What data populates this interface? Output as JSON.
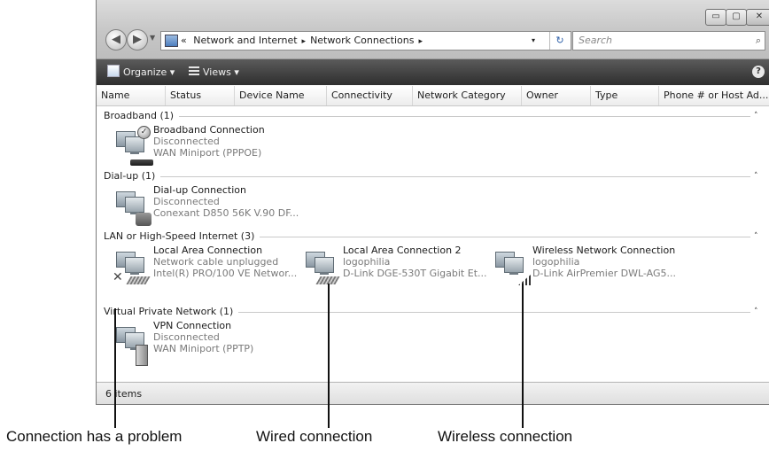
{
  "window": {
    "controls": {
      "minimize": "▭",
      "maximize": "▢",
      "close": "✕"
    }
  },
  "nav": {
    "back_glyph": "◀",
    "forward_glyph": "▶",
    "history_drop": "▼"
  },
  "address": {
    "overflow": "«",
    "crumbs": [
      "Network and Internet",
      "Network Connections"
    ],
    "separator": "▸",
    "drop": "▾",
    "refresh": "↻"
  },
  "search": {
    "placeholder": "Search",
    "icon": "⌕"
  },
  "toolbar": {
    "organize_label": "Organize ▾",
    "views_label": "Views ▾",
    "help_label": "?"
  },
  "columns": [
    "Name",
    "Status",
    "Device Name",
    "Connectivity",
    "Network Category",
    "Owner",
    "Type",
    "Phone # or Host Ad..."
  ],
  "groups": [
    {
      "title": "Broadband (1)",
      "items": [
        {
          "name": "Broadband Connection",
          "line2": "Disconnected",
          "line3": "WAN Miniport (PPPOE)",
          "icon": "broadband-connection-icon"
        }
      ]
    },
    {
      "title": "Dial-up (1)",
      "items": [
        {
          "name": "Dial-up Connection",
          "line2": "Disconnected",
          "line3": "Conexant D850 56K V.90 DF...",
          "icon": "dialup-connection-icon"
        }
      ]
    },
    {
      "title": "LAN or High-Speed Internet (3)",
      "items": [
        {
          "name": "Local Area Connection",
          "line2": "Network cable unplugged",
          "line3": "Intel(R) PRO/100 VE Networ...",
          "icon": "lan-connection-problem-icon"
        },
        {
          "name": "Local Area Connection 2",
          "line2": "logophilia",
          "line3": "D-Link DGE-530T Gigabit Et...",
          "icon": "wired-connection-icon"
        },
        {
          "name": "Wireless Network Connection",
          "line2": "logophilia",
          "line3": "D-Link AirPremier DWL-AG5...",
          "icon": "wireless-connection-icon"
        }
      ]
    },
    {
      "title": "Virtual Private Network (1)",
      "items": [
        {
          "name": "VPN Connection",
          "line2": "Disconnected",
          "line3": "WAN Miniport (PPTP)",
          "icon": "vpn-connection-icon"
        }
      ]
    }
  ],
  "group_chevron": "˄",
  "status": {
    "count": "6 items"
  },
  "callouts": {
    "problem": "Connection has a problem",
    "wired": "Wired connection",
    "wireless": "Wireless connection"
  }
}
